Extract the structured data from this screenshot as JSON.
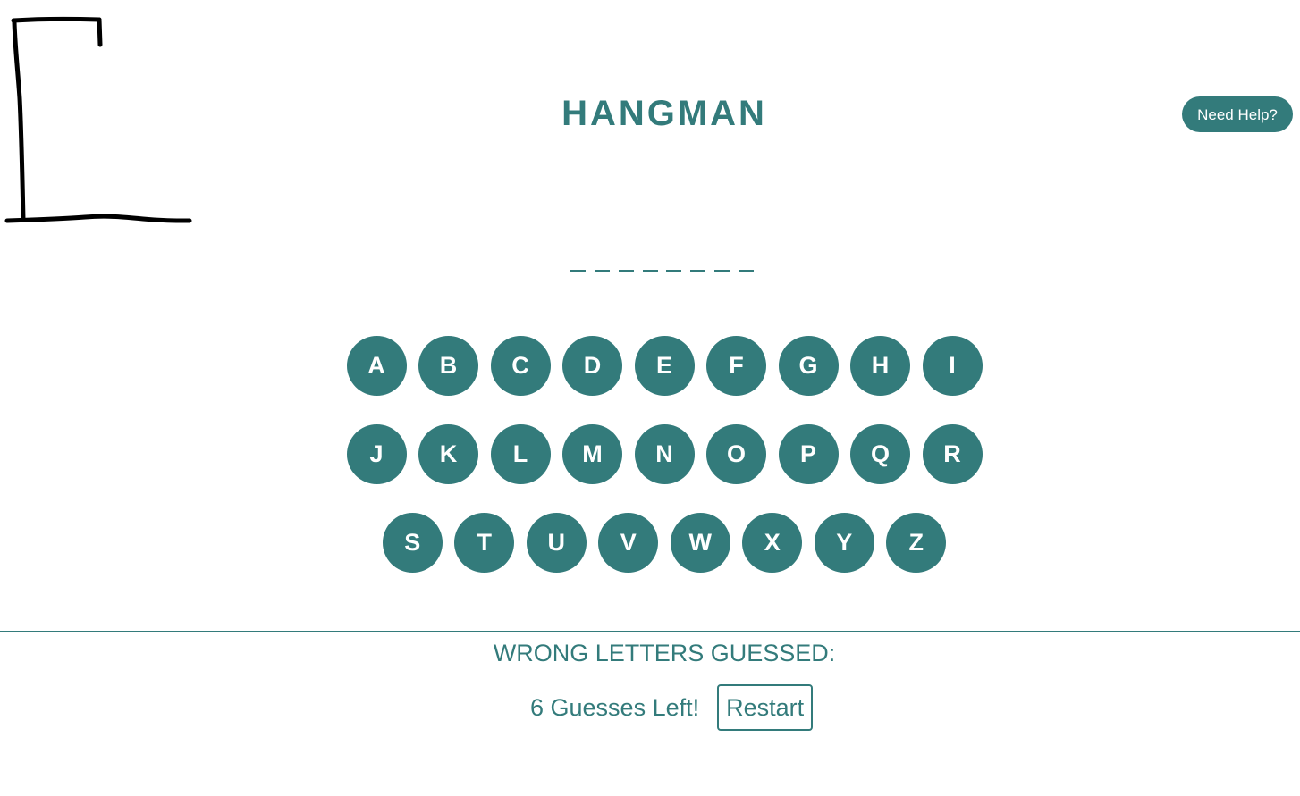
{
  "app": {
    "title": "HANGMAN",
    "accent_color": "#337b7b"
  },
  "header": {
    "help_label": "Need Help?"
  },
  "word": {
    "blank_count": 8
  },
  "keyboard": {
    "rows": [
      [
        "A",
        "B",
        "C",
        "D",
        "E",
        "F",
        "G",
        "H",
        "I"
      ],
      [
        "J",
        "K",
        "L",
        "M",
        "N",
        "O",
        "P",
        "Q",
        "R"
      ],
      [
        "S",
        "T",
        "U",
        "V",
        "W",
        "X",
        "Y",
        "Z"
      ]
    ]
  },
  "status": {
    "wrong_label": "WRONG LETTERS GUESSED:",
    "wrong_letters": "",
    "guesses_left": "6 Guesses Left!",
    "restart_label": "Restart"
  }
}
